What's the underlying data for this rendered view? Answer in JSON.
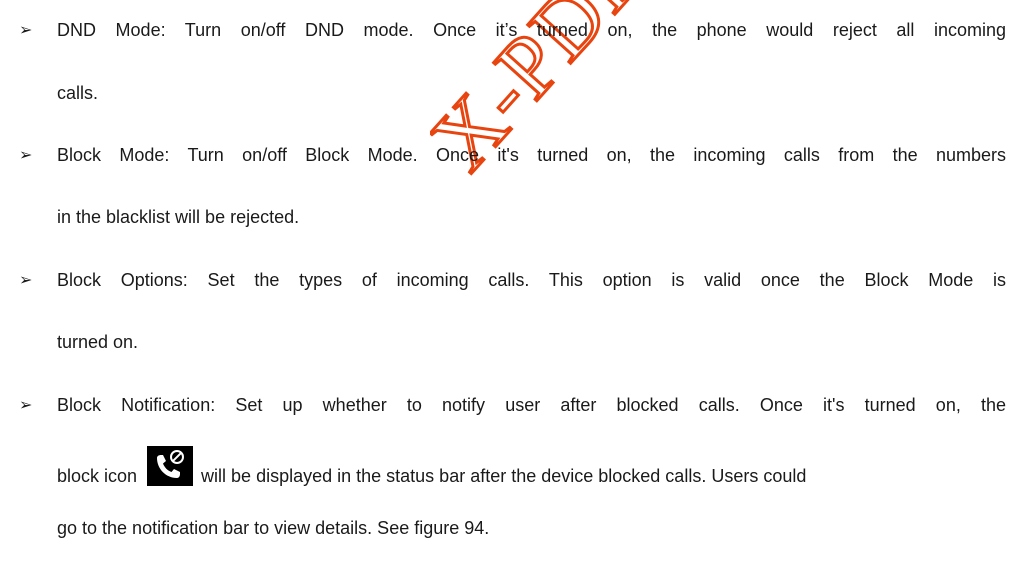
{
  "bullets": [
    {
      "lines": [
        "DND Mode: Turn on/off DND mode. Once it’s turned on, the phone would reject all incoming",
        "calls."
      ]
    },
    {
      "lines": [
        "Block Mode: Turn on/off Block Mode. Once it's turned on, the incoming calls from the numbers",
        "in the blacklist will be rejected."
      ]
    },
    {
      "lines": [
        "Block Options: Set the types of incoming calls. This option is valid once the Block Mode is",
        "turned on."
      ]
    },
    {
      "lines": [
        "Block Notification: Set up whether to notify user after blocked calls. Once it's turned on, the",
        "block icon",
        "will be displayed in the status bar after the device blocked calls. Users could",
        "go to the notification bar to view details. See figure 94."
      ]
    }
  ],
  "bullet_marker": "➢",
  "icons": {
    "block_icon": "blocked-call-icon"
  },
  "watermark": {
    "text": "X-PDF",
    "color": "#e8440f"
  }
}
